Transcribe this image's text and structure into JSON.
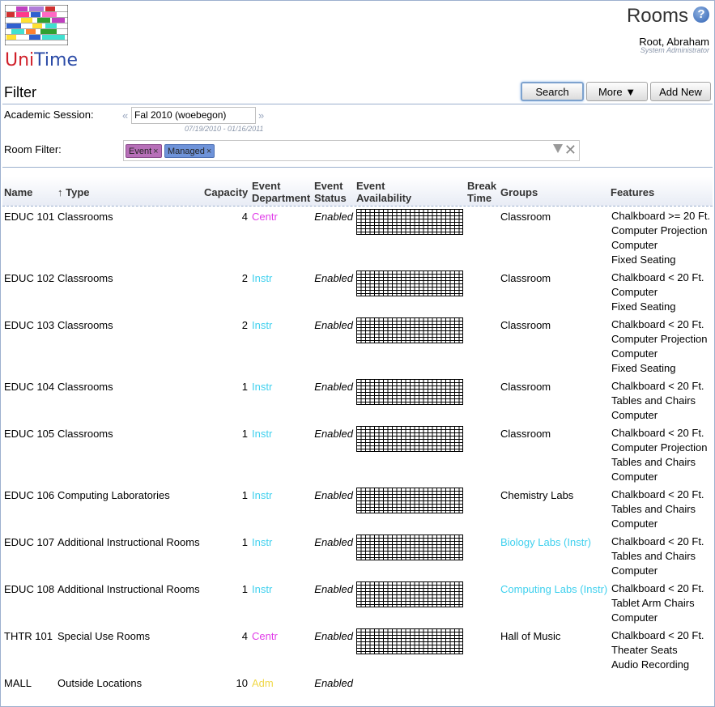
{
  "app": {
    "logo_text_u": "Uni",
    "logo_text_t": "Time",
    "page_title": "Rooms"
  },
  "user": {
    "name": "Root, Abraham",
    "role": "System Administrator"
  },
  "filter": {
    "title": "Filter",
    "search_label": "Search",
    "more_label": "More",
    "add_label": "Add New",
    "session_label": "Academic Session:",
    "session_value": "Fal 2010 (woebegon)",
    "session_dates": "07/19/2010 - 01/16/2011",
    "room_filter_label": "Room Filter:",
    "chips": [
      "Event",
      "Managed"
    ]
  },
  "table": {
    "headers": {
      "name": "Name",
      "type": "↑ Type",
      "capacity": "Capacity",
      "dept1": "Event",
      "dept2": "Department",
      "status1": "Event",
      "status2": "Status",
      "avail1": "Event",
      "avail2": "Availability",
      "break1": "Break",
      "break2": "Time",
      "groups": "Groups",
      "features": "Features"
    },
    "rows": [
      {
        "name": "EDUC 101",
        "type": "Classrooms",
        "capacity": "4",
        "dept": "Centr",
        "status": "Enabled",
        "groups": "Classroom",
        "features": [
          "Chalkboard >= 20 Ft.",
          "Computer Projection",
          "Computer",
          "Fixed Seating"
        ]
      },
      {
        "name": "EDUC 102",
        "type": "Classrooms",
        "capacity": "2",
        "dept": "Instr",
        "status": "Enabled",
        "groups": "Classroom",
        "features": [
          "Chalkboard < 20 Ft.",
          "Computer",
          "Fixed Seating"
        ]
      },
      {
        "name": "EDUC 103",
        "type": "Classrooms",
        "capacity": "2",
        "dept": "Instr",
        "status": "Enabled",
        "groups": "Classroom",
        "features": [
          "Chalkboard < 20 Ft.",
          "Computer Projection",
          "Computer",
          "Fixed Seating"
        ]
      },
      {
        "name": "EDUC 104",
        "type": "Classrooms",
        "capacity": "1",
        "dept": "Instr",
        "status": "Enabled",
        "groups": "Classroom",
        "features": [
          "Chalkboard < 20 Ft.",
          "Tables and Chairs",
          "Computer"
        ]
      },
      {
        "name": "EDUC 105",
        "type": "Classrooms",
        "capacity": "1",
        "dept": "Instr",
        "status": "Enabled",
        "groups": "Classroom",
        "features": [
          "Chalkboard < 20 Ft.",
          "Computer Projection",
          "Tables and Chairs",
          "Computer"
        ]
      },
      {
        "name": "EDUC 106",
        "type": "Computing Laboratories",
        "capacity": "1",
        "dept": "Instr",
        "status": "Enabled",
        "groups": "Chemistry Labs",
        "features": [
          "Chalkboard < 20 Ft.",
          "Tables and Chairs",
          "Computer"
        ]
      },
      {
        "name": "EDUC 107",
        "type": "Additional Instructional Rooms",
        "capacity": "1",
        "dept": "Instr",
        "status": "Enabled",
        "groups": "Biology Labs (Instr)",
        "features": [
          "Chalkboard < 20 Ft.",
          "Tables and Chairs",
          "Computer"
        ]
      },
      {
        "name": "EDUC 108",
        "type": "Additional Instructional Rooms",
        "capacity": "1",
        "dept": "Instr",
        "status": "Enabled",
        "groups": "Computing Labs (Instr)",
        "features": [
          "Chalkboard < 20 Ft.",
          "Tablet Arm Chairs",
          "Computer"
        ]
      },
      {
        "name": "THTR 101",
        "type": "Special Use Rooms",
        "capacity": "4",
        "dept": "Centr",
        "status": "Enabled",
        "groups": "Hall of Music",
        "features": [
          "Chalkboard < 20 Ft.",
          "Theater Seats",
          "Audio Recording"
        ]
      },
      {
        "name": "MALL",
        "type": "Outside Locations",
        "capacity": "10",
        "dept": "Adm",
        "status": "Enabled",
        "groups": "",
        "features": []
      }
    ]
  },
  "colors": {
    "centr": "#e03ce8",
    "instr": "#3fd0ee",
    "adm": "#f0d848",
    "link_group": "#3fd0ee"
  },
  "icons": {
    "help": "question-mark-circle-icon",
    "dropdown": "triangle-down-icon",
    "funnel": "funnel-icon",
    "clear": "close-icon"
  }
}
